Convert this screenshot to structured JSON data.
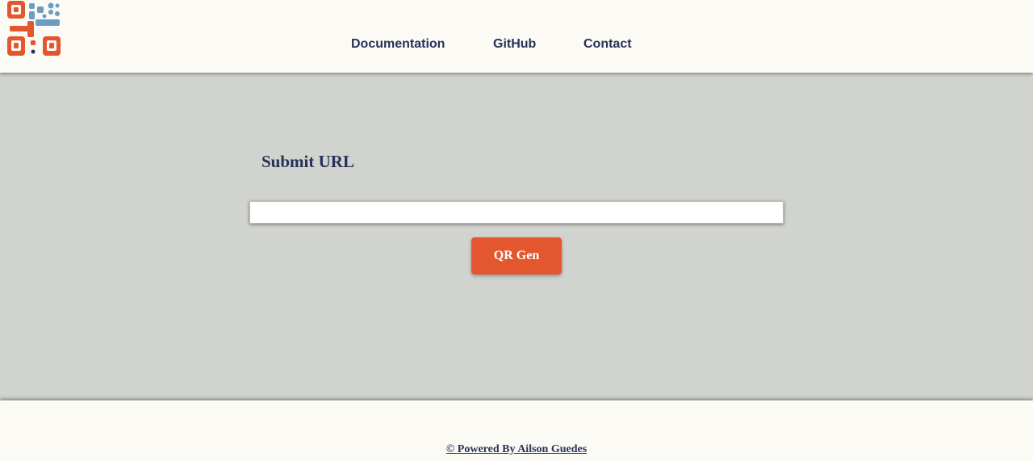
{
  "header": {
    "logo_icon": "qr-code-logo-icon",
    "nav": {
      "documentation": "Documentation",
      "github": "GitHub",
      "contact": "Contact"
    }
  },
  "main": {
    "title": "Submit URL",
    "url_input": {
      "value": "",
      "placeholder": ""
    },
    "button_label": "QR Gen"
  },
  "footer": {
    "credit": "© Powered By Ailson Guedes"
  },
  "colors": {
    "accent_orange": "#e4572e",
    "accent_blue": "#6a9cc4",
    "text_navy": "#283259",
    "main_bg": "#d1d3ce",
    "header_bg": "#fbfaf4"
  }
}
